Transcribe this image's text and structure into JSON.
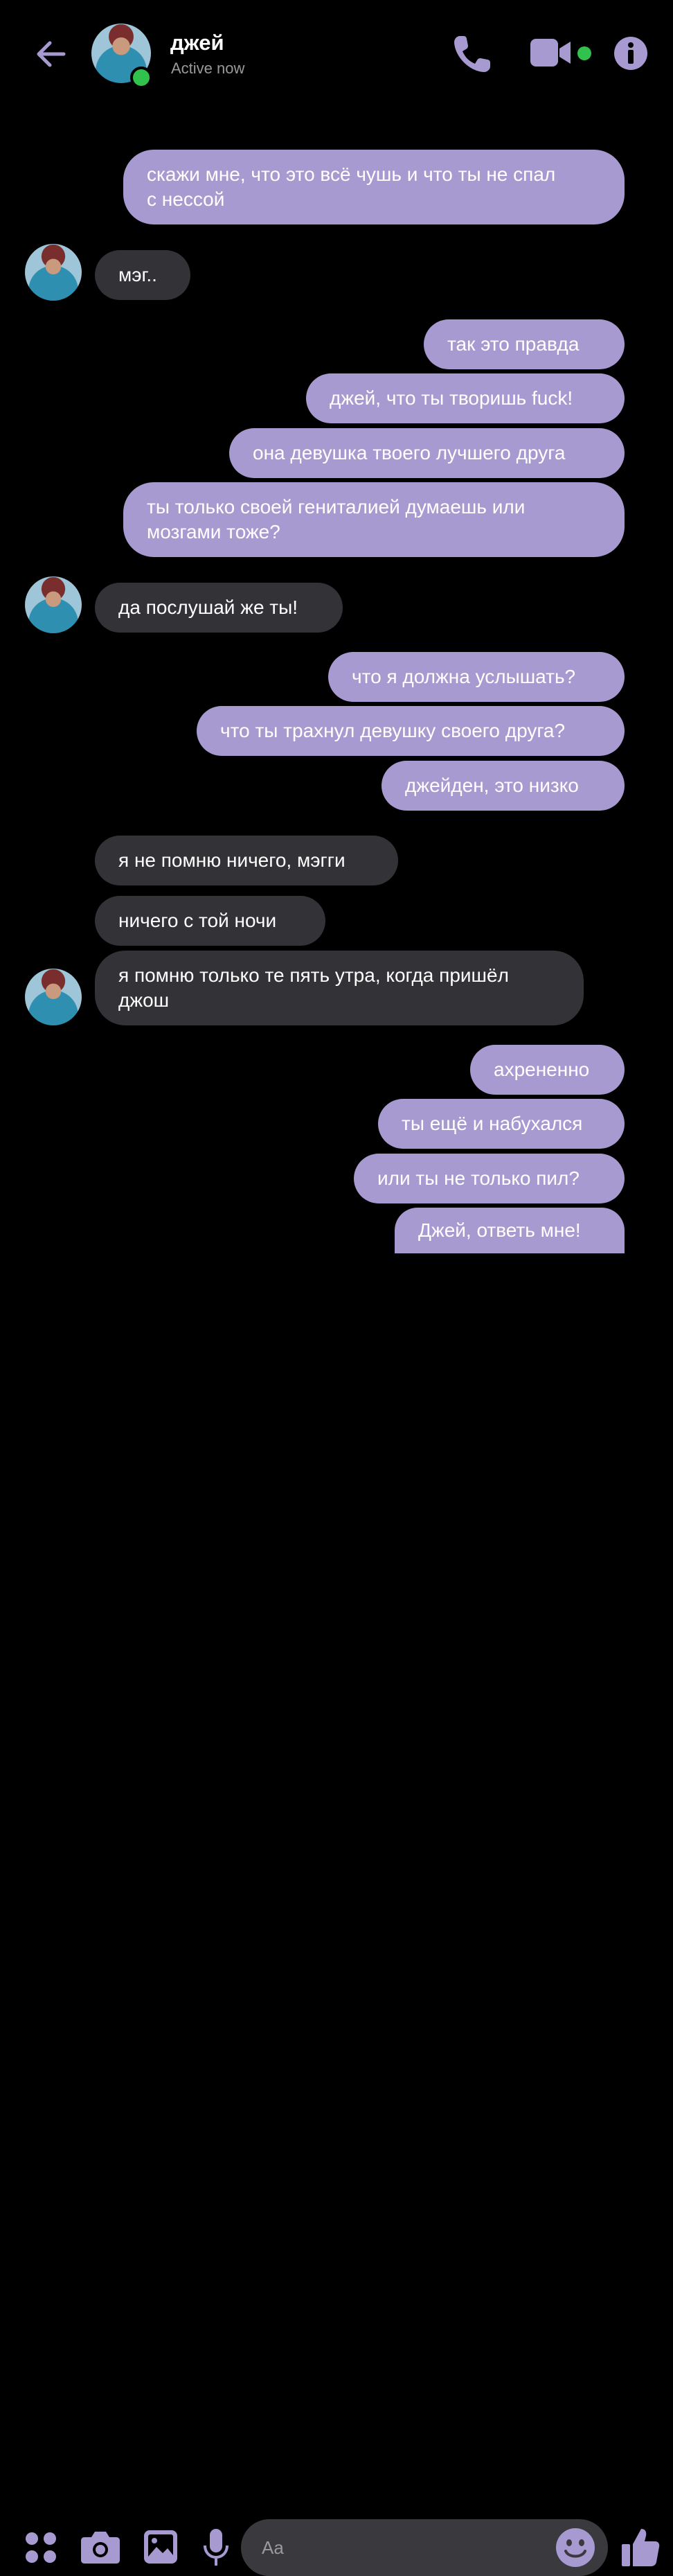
{
  "header": {
    "title": "джей",
    "status": "Active now",
    "accent": "#a79ad0",
    "presence_color": "#31c24d"
  },
  "messages": [
    {
      "side": "out",
      "text": "скажи мне, что это всё чушь и что ты не спал\nс нессой"
    },
    {
      "side": "in",
      "text": "мэг.."
    },
    {
      "side": "out",
      "text": "так это правда"
    },
    {
      "side": "out",
      "text": "джей, что ты творишь fuck!"
    },
    {
      "side": "out",
      "text": "она девушка твоего лучшего друга"
    },
    {
      "side": "out",
      "text": "ты только своей гениталией думаешь или\nмозгами тоже?"
    },
    {
      "side": "in",
      "text": "да послушай же ты!"
    },
    {
      "side": "out",
      "text": "что я должна услышать?"
    },
    {
      "side": "out",
      "text": "что ты трахнул девушку своего друга?"
    },
    {
      "side": "out",
      "text": "джейден, это низко"
    },
    {
      "side": "in",
      "text": "я не помню ничего, мэгги"
    },
    {
      "side": "in",
      "text": "ничего с той ночи"
    },
    {
      "side": "in",
      "text": "я помню только те пять утра, когда пришёл\nджош"
    },
    {
      "side": "out",
      "text": "ахрененно"
    },
    {
      "side": "out",
      "text": "ты ещё и набухался"
    },
    {
      "side": "out",
      "text": "или ты не только пил?"
    },
    {
      "side": "out",
      "text": "Джей, ответь мне!"
    }
  ],
  "composer": {
    "placeholder": "Aa",
    "icons": [
      "apps-icon",
      "camera-icon",
      "gallery-icon",
      "microphone-icon",
      "emoji-icon",
      "thumbs-up-icon"
    ]
  },
  "colors": {
    "outgoing_bubble": "#a79ad0",
    "incoming_bubble": "#333236",
    "background": "#000000"
  }
}
